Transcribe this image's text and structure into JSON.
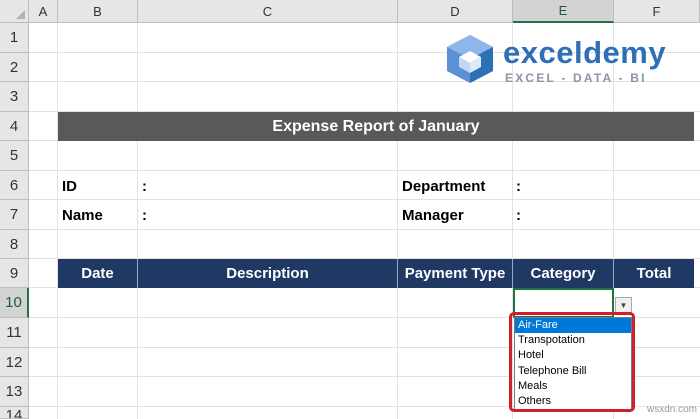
{
  "columns": [
    "A",
    "B",
    "C",
    "D",
    "E",
    "F"
  ],
  "rows": [
    "1",
    "2",
    "3",
    "4",
    "5",
    "6",
    "7",
    "8",
    "9",
    "10",
    "11",
    "12",
    "13",
    "14"
  ],
  "selected_column": "E",
  "selected_row": "10",
  "logo": {
    "name": "exceldemy",
    "tagline": "EXCEL - DATA - BI"
  },
  "report_title": "Expense Report of January",
  "fields": {
    "id_label": "ID",
    "name_label": "Name",
    "department_label": "Department",
    "manager_label": "Manager",
    "colon": ":"
  },
  "table_headers": [
    "Date",
    "Description",
    "Payment Type",
    "Category",
    "Total"
  ],
  "dropdown": {
    "selected": "Air-Fare",
    "options": [
      "Air-Fare",
      "Transpotation",
      "Hotel",
      "Telephone Bill",
      "Meals",
      "Others"
    ]
  },
  "colors": {
    "title_bar": "#595959",
    "table_header": "#203864",
    "highlight_frame": "#d01e2a",
    "selection": "#0078d7",
    "logo_text": "#2f6fb6"
  },
  "watermark": "wsxdn.com"
}
